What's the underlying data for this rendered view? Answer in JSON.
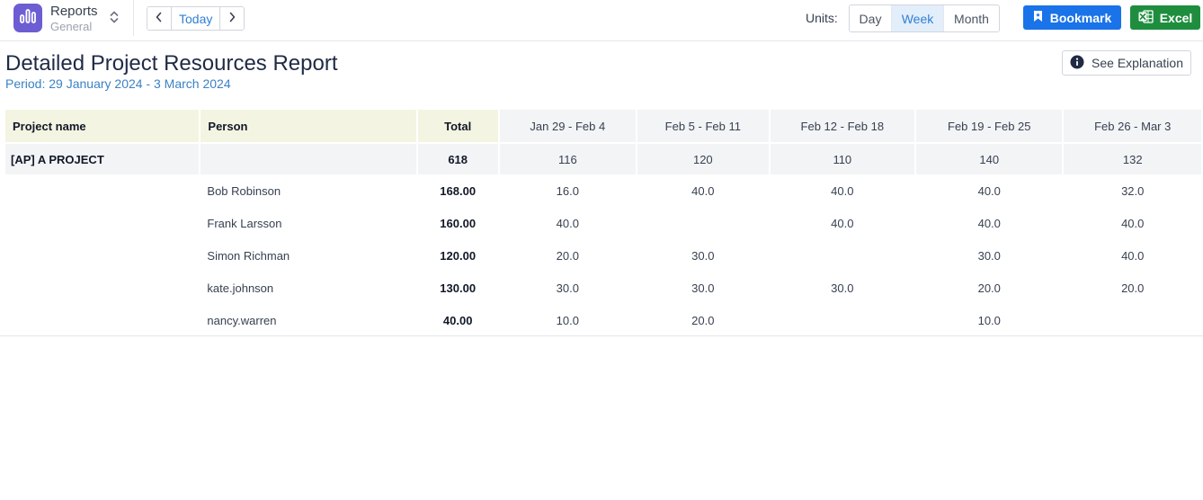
{
  "app": {
    "title": "Reports",
    "subtitle": "General",
    "logo_icon": "bar-chart-icon",
    "brand_color": "#6d5dd3"
  },
  "nav": {
    "prev_icon": "chevron-left-icon",
    "today_label": "Today",
    "next_icon": "chevron-right-icon"
  },
  "units": {
    "label": "Units:",
    "options": [
      "Day",
      "Week",
      "Month"
    ],
    "selected": "Week"
  },
  "actions": {
    "bookmark_label": "Bookmark",
    "bookmark_icon": "bookmark-icon",
    "bookmark_color": "#1a73e8",
    "excel_label": "Excel",
    "excel_icon": "excel-icon",
    "excel_color": "#1e8e3e"
  },
  "report": {
    "title": "Detailed Project Resources Report",
    "period": "Period: 29 January 2024 - 3 March 2024",
    "explain_label": "See Explanation",
    "explain_icon": "info-icon"
  },
  "table": {
    "headers": {
      "project": "Project name",
      "person": "Person",
      "total": "Total",
      "weeks": [
        "Jan 29 - Feb 4",
        "Feb 5 - Feb 11",
        "Feb 12 - Feb 18",
        "Feb 19 - Feb 25",
        "Feb 26 - Mar 3"
      ]
    },
    "group": {
      "project": "[AP] A PROJECT",
      "total": "618",
      "weeks": [
        "116",
        "120",
        "110",
        "140",
        "132"
      ]
    },
    "rows": [
      {
        "person": "Bob Robinson",
        "total": "168.00",
        "weeks": [
          "16.0",
          "40.0",
          "40.0",
          "40.0",
          "32.0"
        ]
      },
      {
        "person": "Frank Larsson",
        "total": "160.00",
        "weeks": [
          "40.0",
          "",
          "40.0",
          "40.0",
          "40.0"
        ]
      },
      {
        "person": "Simon Richman",
        "total": "120.00",
        "weeks": [
          "20.0",
          "30.0",
          "",
          "30.0",
          "40.0"
        ]
      },
      {
        "person": "kate.johnson",
        "total": "130.00",
        "weeks": [
          "30.0",
          "30.0",
          "30.0",
          "20.0",
          "20.0"
        ]
      },
      {
        "person": "nancy.warren",
        "total": "40.00",
        "weeks": [
          "10.0",
          "20.0",
          "",
          "10.0",
          ""
        ]
      }
    ]
  }
}
